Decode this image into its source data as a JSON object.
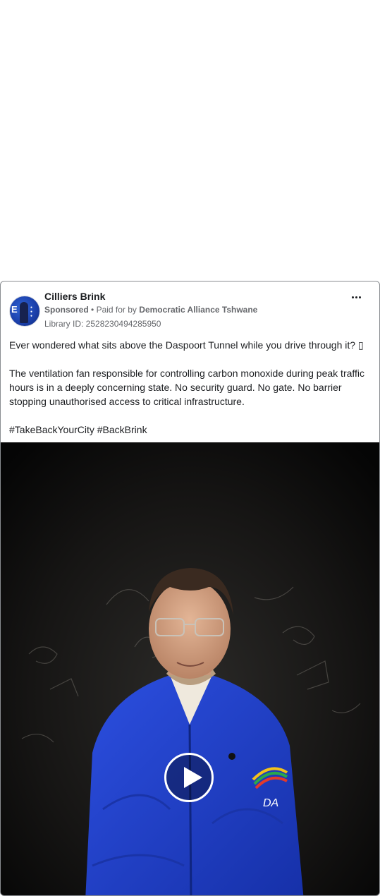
{
  "ad": {
    "page_name": "Cilliers Brink",
    "sponsored_label": "Sponsored",
    "paid_for_prefix": "Paid for by",
    "funder": "Democratic Alliance Tshwane",
    "library_id": "Library ID: 2528230494285950",
    "body": [
      "Ever wondered what sits above the Daspoort Tunnel while you drive through it? ▯",
      "The ventilation fan responsible for controlling carbon monoxide during peak traffic hours is in a deeply concerning state. No security guard. No gate. No barrier stopping unauthorised access to critical infrastructure.",
      "#TakeBackYourCity #BackBrink"
    ],
    "more_icon": "more-horizontal-icon",
    "play_icon": "play-icon",
    "jacket_logo": "DA",
    "colors": {
      "name": "#1c1e21",
      "meta": "#65676b",
      "jacket": "#1f3fc4",
      "video_bg": "#0c0b0b"
    }
  }
}
